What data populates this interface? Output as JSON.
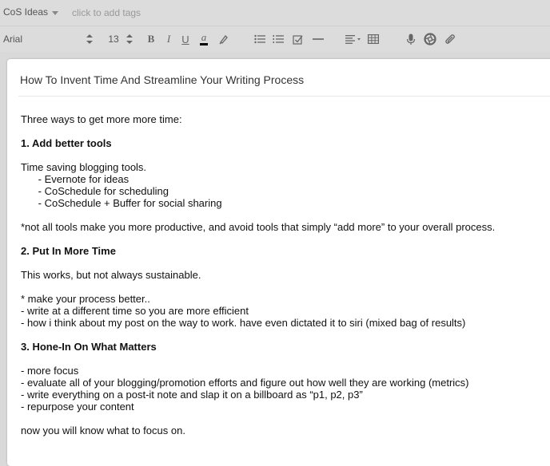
{
  "header": {
    "notebook": "CoS Ideas",
    "tags_placeholder": "click to add tags"
  },
  "toolbar": {
    "font": "Arial",
    "font_size": "13",
    "bold_label": "B",
    "italic_label": "I",
    "underline_label": "U",
    "color_label": "a"
  },
  "note": {
    "title": "How To Invent Time And Streamline Your Writing Process",
    "lines": [
      {
        "text": "Three ways to get more more time:",
        "bold": false
      },
      {
        "text": "",
        "bold": false
      },
      {
        "text": "1. Add better tools",
        "bold": true
      },
      {
        "text": "",
        "bold": false
      },
      {
        "text": "Time saving blogging tools.",
        "bold": false
      },
      {
        "text": "      - Evernote for ideas",
        "bold": false
      },
      {
        "text": "      - CoSchedule for scheduling",
        "bold": false
      },
      {
        "text": "      - CoSchedule + Buffer for social sharing",
        "bold": false
      },
      {
        "text": "",
        "bold": false
      },
      {
        "text": "*not all tools make you more productive, and avoid tools that simply “add more” to your overall process.",
        "bold": false
      },
      {
        "text": "",
        "bold": false
      },
      {
        "text": "2. Put In More Time",
        "bold": true
      },
      {
        "text": "",
        "bold": false
      },
      {
        "text": "This works, but not always sustainable.",
        "bold": false
      },
      {
        "text": "",
        "bold": false
      },
      {
        "text": "* make your process better..",
        "bold": false
      },
      {
        "text": "- write at a different time so you are more efficient",
        "bold": false
      },
      {
        "text": "- how i think about my post on the way to work. have even dictated it to siri (mixed bag of results)",
        "bold": false
      },
      {
        "text": "",
        "bold": false
      },
      {
        "text": "3. Hone-In On What Matters",
        "bold": true
      },
      {
        "text": "",
        "bold": false
      },
      {
        "text": "- more focus",
        "bold": false
      },
      {
        "text": "- evaluate all of your blogging/promotion efforts and figure out how well they are working (metrics)",
        "bold": false
      },
      {
        "text": "- write everything on a post-it note and slap it on a billboard as “p1, p2, p3”",
        "bold": false
      },
      {
        "text": "- repurpose your content",
        "bold": false
      },
      {
        "text": "",
        "bold": false
      },
      {
        "text": "now you will know what to focus on.",
        "bold": false
      }
    ]
  }
}
